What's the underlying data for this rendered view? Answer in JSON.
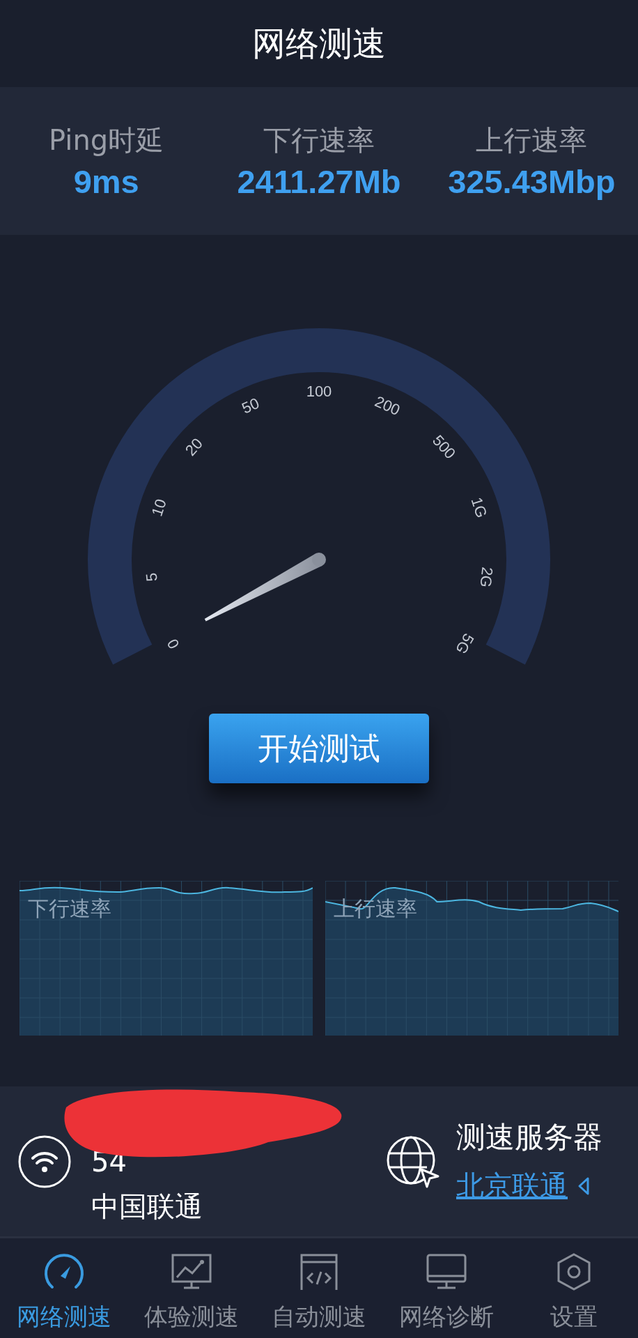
{
  "title": "网络测速",
  "stats": [
    {
      "label": "Ping时延",
      "value": "9ms"
    },
    {
      "label": "下行速率",
      "value": "2411.27Mb"
    },
    {
      "label": "上行速率",
      "value": "325.43Mbp"
    }
  ],
  "gauge": {
    "ticks": [
      "0",
      "5",
      "10",
      "20",
      "50",
      "100",
      "200",
      "500",
      "1G",
      "2G",
      "5G"
    ]
  },
  "start_button": "开始测试",
  "charts": [
    {
      "label": "下行速率",
      "kind": "picture"
    },
    {
      "label": "上行速率",
      "kind": "picture"
    }
  ],
  "network": {
    "line_2": "54",
    "carrier": "中国联通",
    "redacted": true
  },
  "server": {
    "label": "测速服务器",
    "name": "北京联通"
  },
  "nav": [
    {
      "label": "网络测速",
      "selected": true
    },
    {
      "label": "体验测速",
      "selected": false
    },
    {
      "label": "自动测速",
      "selected": false
    },
    {
      "label": "网络诊断",
      "selected": false
    },
    {
      "label": "设置",
      "selected": false
    }
  ]
}
